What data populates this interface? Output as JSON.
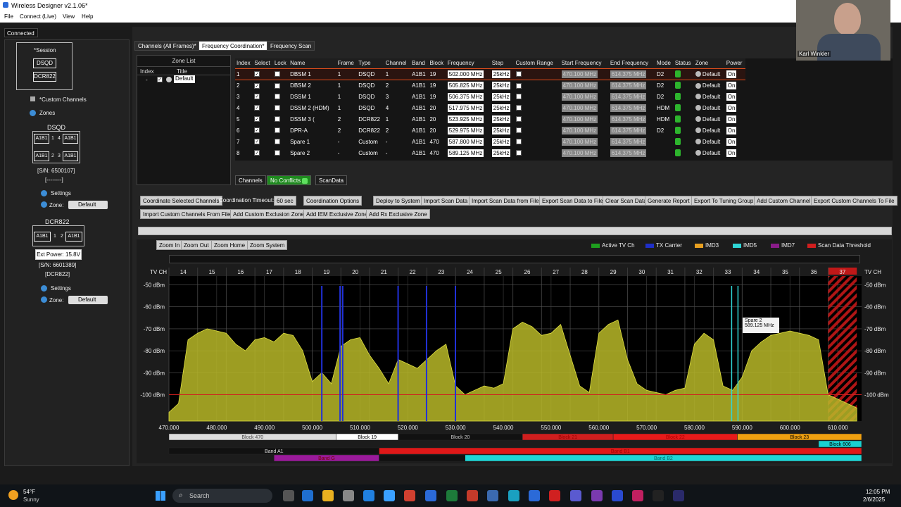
{
  "app": {
    "title": "Wireless Designer v2.1.06*",
    "menu": [
      "File",
      "Connect (Live)",
      "View",
      "Help"
    ],
    "status": "Connected"
  },
  "left": {
    "session": "*Session",
    "session_items": [
      "DSQD",
      "DCR822"
    ],
    "custom_channels": "*Custom Channels",
    "zones": "Zones",
    "dev1": {
      "name": "DSQD",
      "cells": [
        "A1B1",
        "1",
        "4",
        "A1B1",
        "A1B1",
        "2",
        "3",
        "A1B1"
      ],
      "sn": "[S/N: 6500107]",
      "name2": "[--------]",
      "settings": "Settings",
      "zone_label": "Zone:",
      "zone_value": "Default"
    },
    "dev2": {
      "name": "DCR822",
      "cells": [
        "A1B1",
        "1",
        "2",
        "A1B1"
      ],
      "ext_power": "Ext Power: 15.8V",
      "sn": "[S/N: 6601389]",
      "name2": "[DCR822]",
      "settings": "Settings",
      "zone_label": "Zone:",
      "zone_value": "Default"
    }
  },
  "tabs": [
    "Channels (All Frames)*",
    "Frequency Coordination*",
    "Frequency Scan"
  ],
  "zone_list": {
    "title": "Zone List",
    "headers": [
      "Index",
      "Title"
    ],
    "rows": [
      {
        "index": "-",
        "title": "Default"
      }
    ]
  },
  "channels": {
    "headers": [
      "Index",
      "Select",
      "Lock",
      "Name",
      "Frame",
      "Type",
      "Channel",
      "Band",
      "Block",
      "Frequency",
      "Step",
      "Custom Range",
      "Start Frequency",
      "End Frequency",
      "Mode",
      "Status",
      "Zone",
      "Power"
    ],
    "rows": [
      {
        "index": "1",
        "name": "DBSM 1",
        "frame": "1",
        "type": "DSQD",
        "channel": "1",
        "band": "A1B1",
        "block": "19",
        "freq": "502.000 MHz",
        "step": "25kHz",
        "start": "470.100 MHz",
        "end": "614.375 MHz",
        "mode": "D2",
        "zone": "Default",
        "power": "On"
      },
      {
        "index": "2",
        "name": "DBSM 2",
        "frame": "1",
        "type": "DSQD",
        "channel": "2",
        "band": "A1B1",
        "block": "19",
        "freq": "505.825 MHz",
        "step": "25kHz",
        "start": "470.100 MHz",
        "end": "614.375 MHz",
        "mode": "D2",
        "zone": "Default",
        "power": "On"
      },
      {
        "index": "3",
        "name": "DSSM 1",
        "frame": "1",
        "type": "DSQD",
        "channel": "3",
        "band": "A1B1",
        "block": "19",
        "freq": "506.375 MHz",
        "step": "25kHz",
        "start": "470.100 MHz",
        "end": "614.375 MHz",
        "mode": "D2",
        "zone": "Default",
        "power": "On"
      },
      {
        "index": "4",
        "name": "DSSM 2 (HDM)",
        "frame": "1",
        "type": "DSQD",
        "channel": "4",
        "band": "A1B1",
        "block": "20",
        "freq": "517.975 MHz",
        "step": "25kHz",
        "start": "470.100 MHz",
        "end": "614.375 MHz",
        "mode": "HDM",
        "zone": "Default",
        "power": "On"
      },
      {
        "index": "5",
        "name": "DSSM 3 (",
        "frame": "2",
        "type": "DCR822",
        "channel": "1",
        "band": "A1B1",
        "block": "20",
        "freq": "523.925 MHz",
        "step": "25kHz",
        "start": "470.100 MHz",
        "end": "614.375 MHz",
        "mode": "HDM",
        "zone": "Default",
        "power": "On"
      },
      {
        "index": "6",
        "name": "DPR-A",
        "frame": "2",
        "type": "DCR822",
        "channel": "2",
        "band": "A1B1",
        "block": "20",
        "freq": "529.975 MHz",
        "step": "25kHz",
        "start": "470.100 MHz",
        "end": "614.375 MHz",
        "mode": "D2",
        "zone": "Default",
        "power": "On"
      },
      {
        "index": "7",
        "name": "Spare 1",
        "frame": "-",
        "type": "Custom",
        "channel": "-",
        "band": "A1B1",
        "block": "470",
        "freq": "587.800 MHz",
        "step": "25kHz",
        "start": "470.100 MHz",
        "end": "614.375 MHz",
        "mode": "",
        "zone": "Default",
        "power": "On"
      },
      {
        "index": "8",
        "name": "Spare 2",
        "frame": "-",
        "type": "Custom",
        "channel": "-",
        "band": "A1B1",
        "block": "470",
        "freq": "589.125 MHz",
        "step": "25kHz",
        "start": "470.100 MHz",
        "end": "614.375 MHz",
        "mode": "",
        "zone": "Default",
        "power": "On"
      }
    ]
  },
  "subtabs": [
    "Channels",
    "No Conflicts",
    "ScanData"
  ],
  "toolbar": {
    "row1": [
      "Coordinate Selected Channels",
      "Coordination Timeout:",
      "60 sec",
      "Coordination Options",
      "Deploy to System",
      "Import Scan Data",
      "Import Scan Data from File",
      "Export Scan Data to File",
      "Clear Scan Data",
      "Generate Report",
      "Export To Tuning Group",
      "Add Custom Channel",
      "Export Custom Channels To File"
    ],
    "row2": [
      "Import Custom Channels From File",
      "Add Custom Exclusion Zone",
      "Add IEM Exclusive Zone",
      "Add Rx Exclusive Zone"
    ]
  },
  "zoom": [
    "Zoom In",
    "Zoom Out",
    "Zoom Home",
    "Zoom System"
  ],
  "legend": [
    {
      "label": "Active TV Ch",
      "color": "#1e9e1e"
    },
    {
      "label": "TX Carrier",
      "color": "#1f2fc8"
    },
    {
      "label": "IMD3",
      "color": "#e8a020"
    },
    {
      "label": "IMD5",
      "color": "#2fd6d6"
    },
    {
      "label": "IMD7",
      "color": "#8a1c8a"
    },
    {
      "label": "Scan Data Threshold",
      "color": "#d01e1e"
    }
  ],
  "chart_data": {
    "type": "area",
    "tv_label": "TV CH",
    "tv_channels": [
      "14",
      "15",
      "16",
      "17",
      "18",
      "19",
      "20",
      "21",
      "22",
      "23",
      "24",
      "25",
      "26",
      "27",
      "28",
      "29",
      "30",
      "31",
      "32",
      "33",
      "34",
      "35",
      "36",
      "37"
    ],
    "y_ticks": [
      "-50 dBm",
      "-60 dBm",
      "-70 dBm",
      "-80 dBm",
      "-90 dBm",
      "-100 dBm"
    ],
    "x_ticks": [
      "470.000",
      "480.000",
      "490.000",
      "500.000",
      "510.000",
      "520.000",
      "530.000",
      "540.000",
      "550.000",
      "560.000",
      "570.000",
      "580.000",
      "590.000",
      "600.000",
      "610.000"
    ],
    "xlim": [
      470,
      615
    ],
    "ylim": [
      -112,
      -46
    ],
    "threshold": -100,
    "tx_carriers": [
      502.0,
      505.825,
      506.375,
      517.975,
      523.925,
      529.975
    ],
    "imd5_lines": [
      587.8,
      589.125
    ],
    "excluded_channel": "37",
    "series": [
      {
        "x": [
          470,
          472,
          474,
          476,
          478,
          480,
          482,
          484,
          486,
          488,
          490,
          492,
          494,
          496,
          498,
          500,
          502,
          504,
          506,
          508,
          510,
          512,
          514,
          516,
          518,
          520,
          522,
          524,
          526,
          528,
          530,
          532,
          534,
          536,
          538,
          540,
          542,
          544,
          546,
          548,
          550,
          552,
          554,
          556,
          558,
          560,
          562,
          564,
          566,
          568,
          570,
          572,
          574,
          576,
          578,
          580,
          582,
          584,
          586,
          588,
          590,
          592,
          594,
          596,
          598,
          600,
          602,
          604,
          606,
          608,
          610,
          612,
          614
        ],
        "y": [
          -108,
          -104,
          -75,
          -72,
          -70,
          -71,
          -72,
          -77,
          -80,
          -75,
          -74,
          -76,
          -72,
          -73,
          -80,
          -94,
          -90,
          -95,
          -78,
          -75,
          -74,
          -82,
          -88,
          -95,
          -84,
          -86,
          -88,
          -84,
          -80,
          -77,
          -96,
          -100,
          -98,
          -96,
          -97,
          -95,
          -70,
          -67,
          -69,
          -73,
          -72,
          -68,
          -82,
          -96,
          -99,
          -72,
          -68,
          -66,
          -84,
          -95,
          -98,
          -99,
          -100,
          -98,
          -97,
          -77,
          -72,
          -75,
          -96,
          -98,
          -92,
          -80,
          -76,
          -73,
          -72,
          -71,
          -72,
          -73,
          -75,
          -100,
          -102,
          -104,
          -106
        ]
      }
    ],
    "tooltip": {
      "name": "Spare 2",
      "freq": "589.125 MHz"
    },
    "blocks_row1": [
      {
        "label": "Block 470",
        "from": 470,
        "to": 505,
        "color": "#dddddd",
        "text": "#444"
      },
      {
        "label": "Block 19",
        "from": 505,
        "to": 518,
        "color": "#ffffff",
        "text": "#000"
      },
      {
        "label": "Block 20",
        "from": 518,
        "to": 544,
        "color": "#111111",
        "text": "#ccc"
      },
      {
        "label": "Block 21",
        "from": 544,
        "to": 563,
        "color": "#d01e1e",
        "text": "#900"
      },
      {
        "label": "Block 22",
        "from": 563,
        "to": 589,
        "color": "#e81a1a",
        "text": "#a00"
      },
      {
        "label": "Block 23",
        "from": 589,
        "to": 615,
        "color": "#f0a010",
        "text": "#000"
      }
    ],
    "blocks_row2": [
      {
        "label": "Block 606",
        "from": 606,
        "to": 615,
        "color": "#19d1d1",
        "text": "#000"
      }
    ],
    "bands_row1": [
      {
        "label": "Band A1",
        "from": 470,
        "to": 514,
        "color": "#111111",
        "text": "#ddd"
      },
      {
        "label": "Band B1",
        "from": 514,
        "to": 615,
        "color": "#e01818",
        "text": "#900"
      }
    ],
    "bands_row2": [
      {
        "label": "Band G",
        "from": 492,
        "to": 514,
        "color": "#9a1a9a",
        "text": "#700"
      },
      {
        "label": "",
        "from": 514,
        "to": 532,
        "color": "#111111",
        "text": "#ddd"
      },
      {
        "label": "Band B2",
        "from": 532,
        "to": 615,
        "color": "#1ed6d6",
        "text": "#066"
      }
    ]
  },
  "webcam_name": "Karl Winkler",
  "taskbar": {
    "temp": "54°F",
    "weather": "Sunny",
    "search": "Search",
    "time": "12:05 PM",
    "date": "2/6/2025"
  }
}
